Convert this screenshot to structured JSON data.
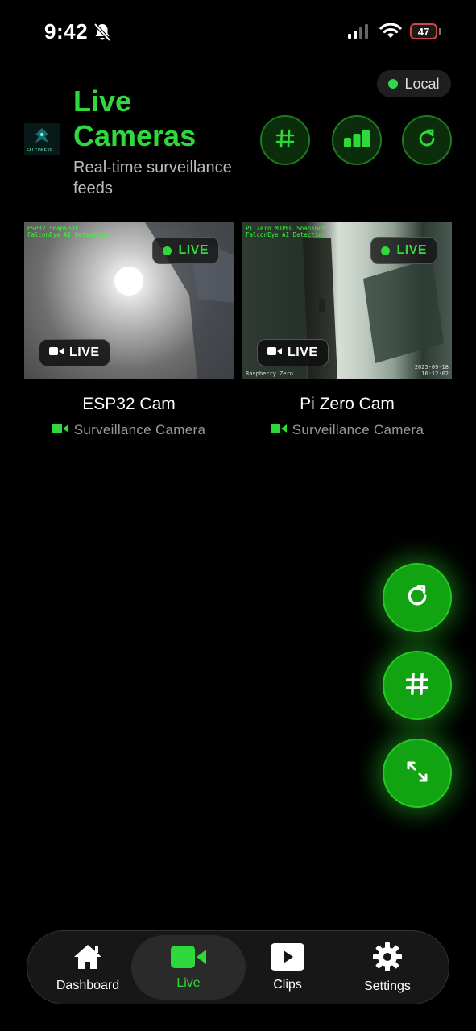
{
  "status_bar": {
    "time": "9:42",
    "battery": "47"
  },
  "header": {
    "connection": "Local",
    "logo_text": "FALCONEYE",
    "title": "Live Cameras",
    "subtitle": "Real-time surveillance feeds",
    "buttons": [
      "grid-icon",
      "bars-icon",
      "refresh-icon"
    ]
  },
  "cameras": [
    {
      "name": "ESP32 Cam",
      "type": "Surveillance Camera",
      "overlay_line1": "ESP32 Snapshot",
      "overlay_line2": "FalconEye AI Detection",
      "live_label": "LIVE",
      "live_badge": "LIVE"
    },
    {
      "name": "Pi Zero Cam",
      "type": "Surveillance Camera",
      "overlay_line1": "Pi Zero MJPEG Snapshot",
      "overlay_line2": "FalconEye AI Detection",
      "live_label": "LIVE",
      "live_badge": "LIVE",
      "stamp_left": "Raspberry Zero",
      "stamp_date": "2025-09-18",
      "stamp_time": "16:12:02"
    }
  ],
  "fabs": [
    "refresh-icon",
    "grid-icon",
    "expand-icon"
  ],
  "tabs": [
    {
      "label": "Dashboard",
      "icon": "home-icon"
    },
    {
      "label": "Live",
      "icon": "video-icon",
      "active": true
    },
    {
      "label": "Clips",
      "icon": "play-icon"
    },
    {
      "label": "Settings",
      "icon": "gear-icon"
    }
  ],
  "colors": {
    "accent": "#2fd93b",
    "background": "#000000"
  }
}
